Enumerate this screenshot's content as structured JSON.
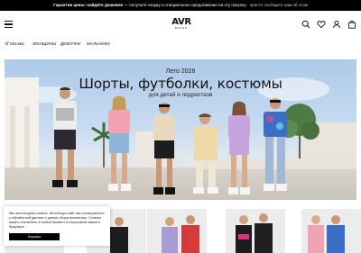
{
  "promo": {
    "bold": "Гарантия цены: найдёте дешевле",
    "middle": " — получите скидку и специальное предложение на эту покупку",
    "muted": " · просто сообщите нам об этом"
  },
  "header": {
    "logo_main": "AVR",
    "logo_sub": "BRAND"
  },
  "nav": {
    "location": "Москва",
    "categories": [
      "Женщины",
      "Девочки",
      "Мальчики"
    ]
  },
  "hero": {
    "subtitle": "Лето 2026",
    "title": "Шорты, футболки, костюмы",
    "caption": "для детей и подростков"
  },
  "cookie": {
    "text": "Мы используем cookies. Используя сайт, вы соглашаетесь с обработкой данных и целью сбора аналитики. Cookies можно отключить в любой момент в настройках вашего браузера",
    "button": "Хорошо"
  },
  "colors": {
    "promo_bg": "#000000",
    "accent": "#000000",
    "hero_sky": "#aec9e8"
  },
  "icons": [
    "menu-icon",
    "search-icon",
    "heart-icon",
    "user-icon",
    "bag-icon",
    "location-arrow-icon"
  ]
}
